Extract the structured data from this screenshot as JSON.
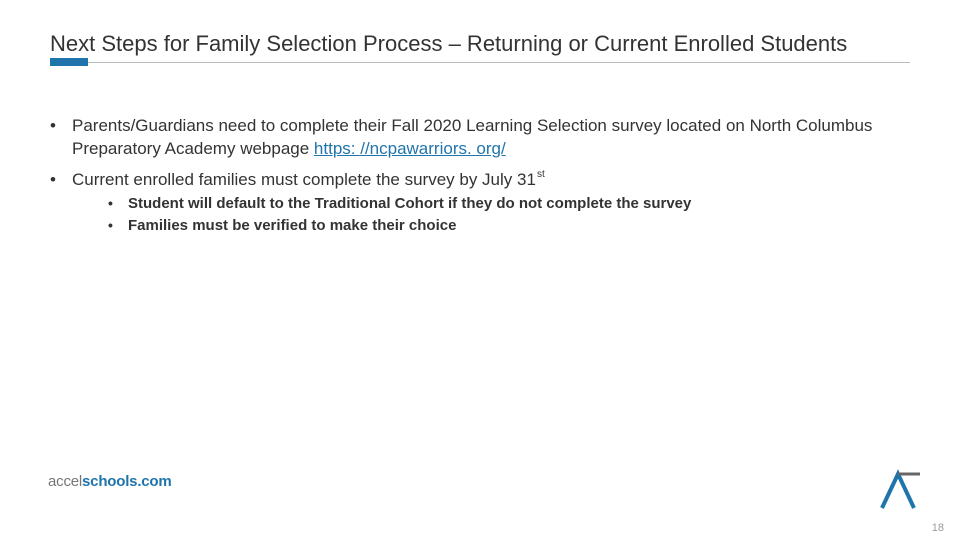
{
  "title": "Next Steps for  Family Selection Process – Returning or Current Enrolled Students",
  "bullets": [
    {
      "pre": "Parents/Guardians need to complete their Fall 2020 Learning Selection survey located on North Columbus Preparatory Academy webpage ",
      "link": "https: //ncpawarriors. org/",
      "post": ""
    },
    {
      "pre": "Current enrolled families must complete the survey by July 31",
      "sup": "st",
      "sub": [
        "Student will default to the Traditional Cohort if they do not complete the survey",
        "Families must be verified to make their choice"
      ]
    }
  ],
  "footer": {
    "brand_a": "accel",
    "brand_b": "schools.com"
  },
  "page_number": "18"
}
